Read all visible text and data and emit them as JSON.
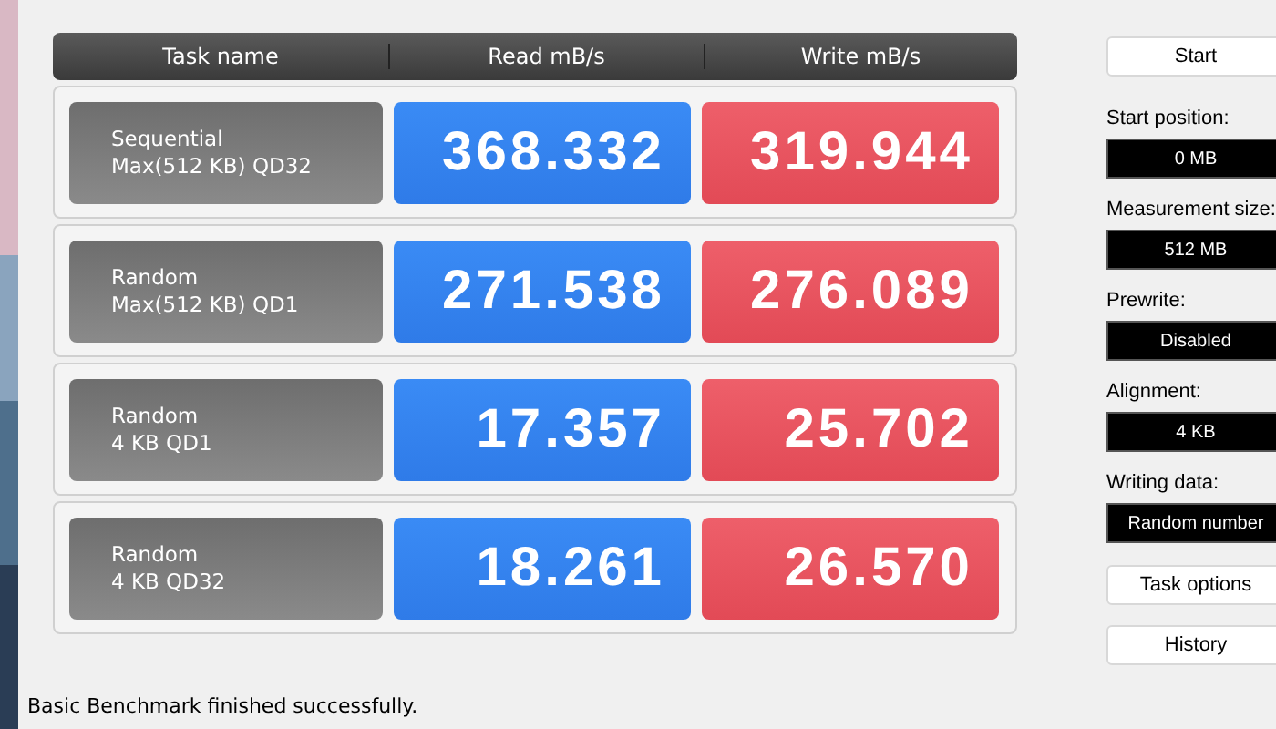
{
  "table": {
    "columns": [
      "Task name",
      "Read mB/s",
      "Write mB/s"
    ],
    "rows": [
      {
        "task": [
          "Sequential",
          "Max(512 KB) QD32"
        ],
        "read": "368.332",
        "write": "319.944"
      },
      {
        "task": [
          "Random",
          "Max(512 KB) QD1"
        ],
        "read": "271.538",
        "write": "276.089"
      },
      {
        "task": [
          "Random",
          "4 KB QD1"
        ],
        "read": "17.357",
        "write": "25.702"
      },
      {
        "task": [
          "Random",
          "4 KB QD32"
        ],
        "read": "18.261",
        "write": "26.570"
      }
    ]
  },
  "side": {
    "start_button": "Start",
    "settings": [
      {
        "label": "Start position:",
        "value": "0 MB"
      },
      {
        "label": "Measurement size:",
        "value": "512 MB"
      },
      {
        "label": "Prewrite:",
        "value": "Disabled"
      },
      {
        "label": "Alignment:",
        "value": "4 KB"
      },
      {
        "label": "Writing data:",
        "value": "Random number"
      }
    ],
    "buttons": [
      "Task options",
      "History"
    ]
  },
  "status_bar": "Basic Benchmark finished successfully."
}
